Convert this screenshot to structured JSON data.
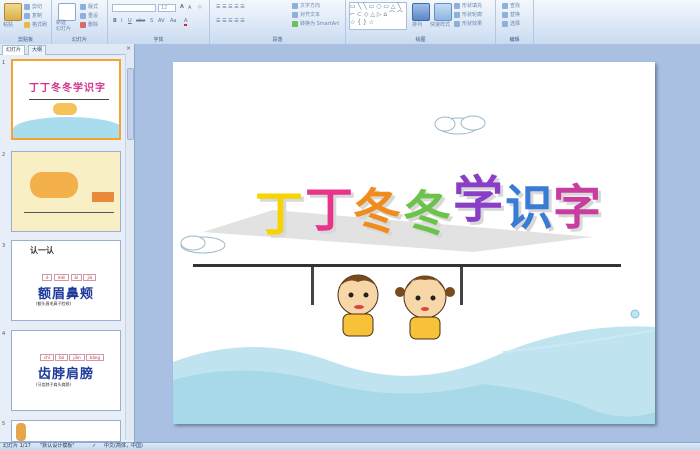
{
  "ribbon": {
    "clipboard": {
      "paste": "粘贴",
      "cut": "剪切",
      "copy": "复制",
      "format_painter": "格式刷",
      "label": "剪贴板"
    },
    "slides": {
      "new_slide": "新建\n幻灯片",
      "layout": "版式",
      "reset": "重设",
      "delete": "删除",
      "label": "幻灯片"
    },
    "font": {
      "size_value": "12",
      "label": "字体"
    },
    "paragraph": {
      "text_direction": "文字方向",
      "align_text": "对齐文本",
      "smartart": "转换为 SmartArt",
      "label": "段落"
    },
    "drawing": {
      "arrange": "排列",
      "quick_styles": "快速样式",
      "shape_fill": "形状填充",
      "shape_outline": "形状轮廓",
      "shape_effects": "形状效果",
      "label": "绘图"
    },
    "editing": {
      "find": "查找",
      "replace": "替换",
      "select": "选择",
      "label": "编辑"
    }
  },
  "left_pane": {
    "tabs": [
      {
        "label": "幻灯片"
      },
      {
        "label": "大纲"
      }
    ],
    "close": "×",
    "slides": [
      {
        "num": "1",
        "title": "丁丁冬冬学识字"
      },
      {
        "num": "2",
        "title": ""
      },
      {
        "num": "3",
        "title": "认一认",
        "pinyin": [
          "é",
          "méi",
          "bì",
          "jiá"
        ],
        "chars": "额眉鼻颊",
        "caption": "(额头眉毛鼻子脸颊)"
      },
      {
        "num": "4",
        "title": "",
        "pinyin": [
          "chǐ",
          "bó",
          "jiān",
          "bǎng"
        ],
        "chars": "齿脖肩膀",
        "caption": "(牙齿脖子肩头肩膀)"
      },
      {
        "num": "5",
        "title": ""
      }
    ]
  },
  "main_slide": {
    "title_chars": [
      "丁",
      "丁",
      "冬",
      "冬",
      "学",
      "识",
      "字"
    ],
    "title_colors": [
      "#f5d400",
      "#e8348a",
      "#f08c1e",
      "#6cc24a",
      "#8a3ec8",
      "#3a7bd5",
      "#c83ea0"
    ]
  },
  "status": {
    "slide_info": "幻灯片 1/17",
    "theme": "\"默认设计模板\"",
    "language": "中文(简体，中国)"
  }
}
